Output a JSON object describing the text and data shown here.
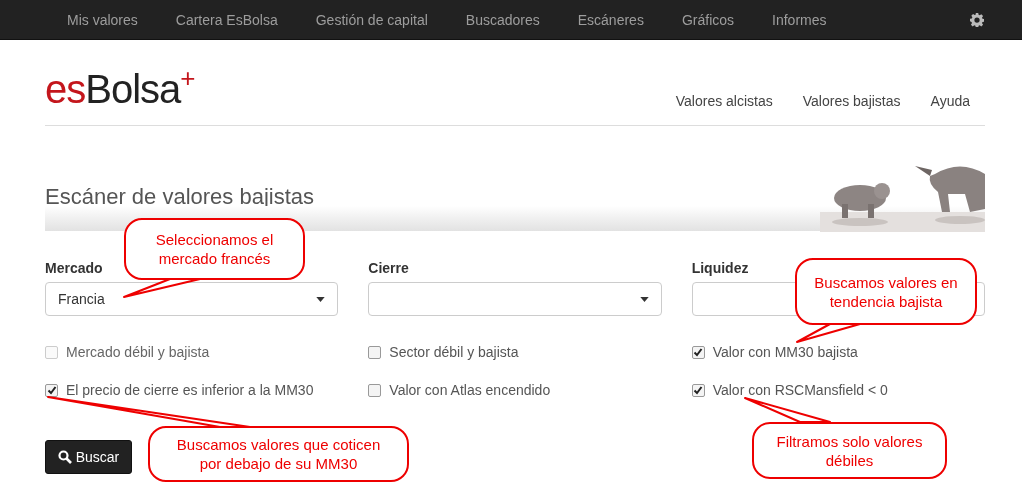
{
  "top_nav": {
    "items": [
      "Mis valores",
      "Cartera EsBolsa",
      "Gestión de capital",
      "Buscadores",
      "Escáneres",
      "Gráficos",
      "Informes"
    ]
  },
  "logo": {
    "prefix": "es",
    "name": "Bolsa",
    "mark": "+"
  },
  "sub_nav": [
    "Valores alcistas",
    "Valores bajistas",
    "Ayuda"
  ],
  "page_title": "Escáner de valores bajistas",
  "banner": {
    "kind": "picture"
  },
  "fields": [
    {
      "label": "Mercado",
      "kind": "select",
      "value": "Francia"
    },
    {
      "label": "Cierre",
      "kind": "select"
    },
    {
      "label": "Liquidez",
      "kind": "input"
    }
  ],
  "checkboxes": [
    {
      "label": "Mercado débil y bajista",
      "checked": false,
      "disabled": true
    },
    {
      "label": "Sector débil y bajista",
      "checked": false,
      "disabled": false
    },
    {
      "label": "Valor con MM30 bajista",
      "checked": true,
      "disabled": false
    },
    {
      "label": "El precio de cierre es inferior a la MM30",
      "checked": true,
      "disabled": false
    },
    {
      "label": "Valor con Atlas encendido",
      "checked": false,
      "disabled": false
    },
    {
      "label": "Valor con RSCMansfield < 0",
      "checked": true,
      "disabled": false
    }
  ],
  "search_button": "Buscar",
  "callouts": [
    "Seleccionamos el mercado francés",
    "Buscamos valores en tendencia bajista",
    "Buscamos valores que coticen por debajo de su MM30",
    "Filtramos solo valores débiles"
  ]
}
